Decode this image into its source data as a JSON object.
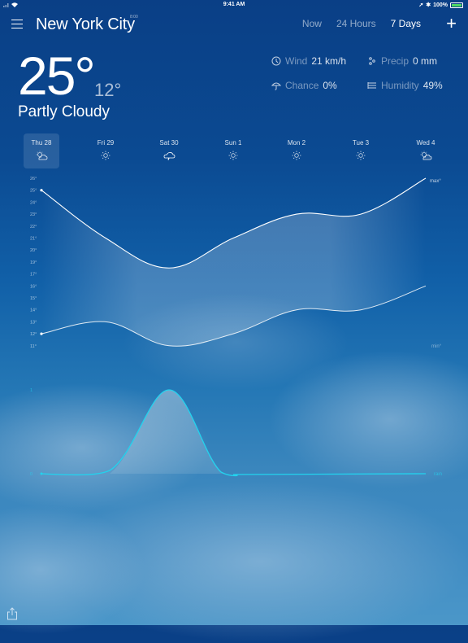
{
  "status_bar": {
    "time": "9:41 AM",
    "battery": "100%"
  },
  "header": {
    "city": "New York City",
    "city_time": "8:00",
    "tabs": [
      {
        "label": "Now",
        "active": false
      },
      {
        "label": "24 Hours",
        "active": false
      },
      {
        "label": "7 Days",
        "active": true
      }
    ],
    "add_label": "+"
  },
  "current": {
    "temp": "25°",
    "low": "12°",
    "condition": "Partly Cloudy",
    "stats": [
      {
        "icon": "wind-icon",
        "label": "Wind",
        "value": "21 km/h"
      },
      {
        "icon": "precip-icon",
        "label": "Precip",
        "value": "0 mm"
      },
      {
        "icon": "umbrella-icon",
        "label": "Chance",
        "value": "0%"
      },
      {
        "icon": "humidity-icon",
        "label": "Humidity",
        "value": "49%"
      }
    ]
  },
  "days": [
    {
      "label": "Thu 28",
      "icon": "partly-cloudy",
      "selected": true
    },
    {
      "label": "Fri 29",
      "icon": "sun",
      "selected": false
    },
    {
      "label": "Sat 30",
      "icon": "rain-cloud",
      "selected": false
    },
    {
      "label": "Sun 1",
      "icon": "sun",
      "selected": false
    },
    {
      "label": "Mon 2",
      "icon": "sun",
      "selected": false
    },
    {
      "label": "Tue 3",
      "icon": "sun",
      "selected": false
    },
    {
      "label": "Wed 4",
      "icon": "partly-cloudy",
      "selected": false
    }
  ],
  "share_label": "share",
  "chart_data": [
    {
      "type": "line",
      "title": "",
      "x": [
        "Thu 28",
        "Fri 29",
        "Sat 30",
        "Sun 1",
        "Mon 2",
        "Tue 3",
        "Wed 4"
      ],
      "yticks": [
        "26°",
        "25°",
        "24°",
        "23°",
        "22°",
        "21°",
        "20°",
        "19°",
        "17°",
        "16°",
        "15°",
        "14°",
        "13°",
        "12°",
        "11°"
      ],
      "ylim": [
        11,
        26
      ],
      "series": [
        {
          "name": "max°",
          "values": [
            25,
            21,
            18,
            21,
            23,
            23,
            26
          ]
        },
        {
          "name": "min°",
          "values": [
            12,
            13,
            11,
            12,
            14,
            14,
            16
          ]
        }
      ],
      "grid": false
    },
    {
      "type": "line",
      "title": "",
      "x": [
        "Thu 28",
        "Fri 29",
        "Sat 30",
        "Sun 1",
        "Mon 2",
        "Tue 3",
        "Wed 4"
      ],
      "yticks": [
        "1",
        "0"
      ],
      "ylim": [
        0,
        1
      ],
      "series": [
        {
          "name": "rain",
          "values": [
            0,
            0,
            1,
            0,
            0,
            0,
            0
          ]
        }
      ],
      "color": "#22d3ee",
      "grid": false
    }
  ]
}
